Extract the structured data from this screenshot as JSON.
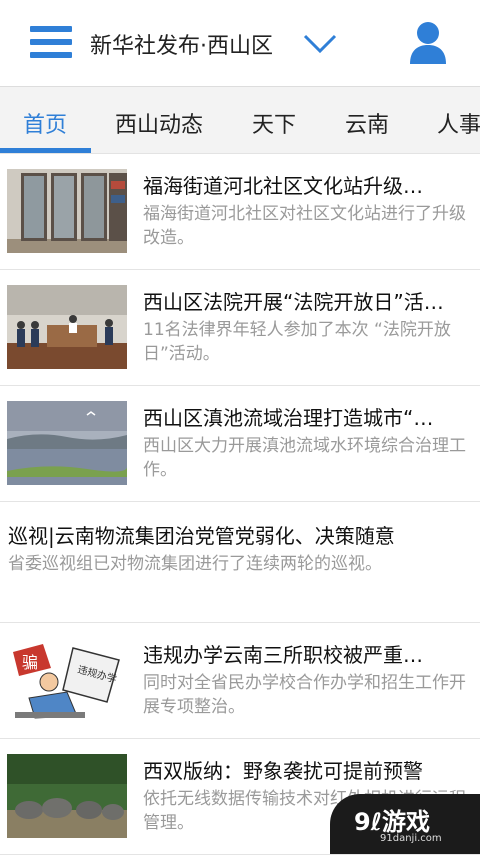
{
  "header": {
    "title": "新华社发布·西山区",
    "menu_icon": "menu-icon",
    "dropdown_icon": "chevron-down-icon",
    "user_icon": "user-icon"
  },
  "tabs": [
    {
      "label": "首页",
      "active": true
    },
    {
      "label": "西山动态"
    },
    {
      "label": "天下"
    },
    {
      "label": "云南"
    },
    {
      "label": "人事"
    }
  ],
  "articles": [
    {
      "headline": "福海街道河北社区文化站升级…",
      "summary": "福海街道河北社区对社区文化站进行了升级改造。"
    },
    {
      "headline": "西山区法院开展“法院开放日”活…",
      "summary": "11名法律界年轻人参加了本次 “法院开放日”活动。"
    },
    {
      "headline": "西山区滇池流域治理打造城市“…",
      "summary": "西山区大力开展滇池流域水环境综合治理工作。"
    },
    {
      "headline": "巡视|云南物流集团治党管党弱化、决策随意",
      "summary": "省委巡视组已对物流集团进行了连续两轮的巡视。"
    },
    {
      "headline": "违规办学云南三所职校被严重…",
      "summary": "同时对全省民办学校合作办学和招生工作开展专项整治。",
      "thumb_text_1": "骗",
      "thumb_text_2": "违规办学"
    },
    {
      "headline": "西双版纳：野象袭扰可提前预警",
      "summary": "依托无线数据传输技术对红外相机进行远程管理。"
    }
  ],
  "watermark": {
    "main": "9ℓ游戏",
    "sub": "91danji.com"
  },
  "colors": {
    "accent": "#2f7fd7"
  }
}
